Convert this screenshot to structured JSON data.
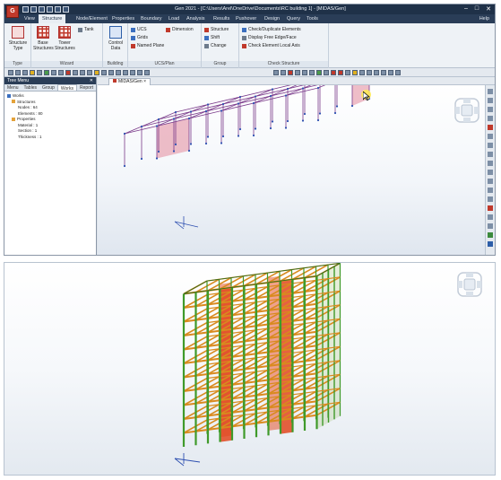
{
  "window": {
    "title": "Gen 2021 - [C:\\Users\\Arel\\OneDrive\\Documents\\RC building 1] - [MIDAS/Gen]",
    "logo_text": "G",
    "controls": [
      "–",
      "□",
      "✕"
    ]
  },
  "menu": {
    "items": [
      "View",
      "Structure",
      "Node/Element",
      "Properties",
      "Boundary",
      "Load",
      "Analysis",
      "Results",
      "Pushover",
      "Design",
      "Query",
      "Tools"
    ],
    "active": "Structure",
    "help": "Help"
  },
  "ribbon": {
    "groups": [
      {
        "label": "Type",
        "buttons": [
          "Structure Type"
        ]
      },
      {
        "label": "Wizard",
        "buttons": [
          "Base Structures",
          "Tower Structures",
          "Tank"
        ]
      },
      {
        "label": "Building",
        "buttons": [
          "Control Data"
        ]
      },
      {
        "label": "UCS/Plan",
        "buttons": [
          "UCS",
          "Grids",
          "Named Plane",
          "Dimension"
        ]
      },
      {
        "label": "Group",
        "buttons": [
          "Structure",
          "Shift",
          "Change"
        ]
      },
      {
        "label": "Check Structure",
        "buttons": [
          "Check/Duplicate Elements",
          "Display Free Edge/Face",
          "Check Element Local Axis"
        ]
      }
    ]
  },
  "nav": {
    "header": "Tree Menu",
    "close": "✕",
    "tabs": [
      "Menu",
      "Tables",
      "Group",
      "Works",
      "Report"
    ],
    "active_tab": "Works",
    "tree": [
      {
        "level": 1,
        "text": "Works"
      },
      {
        "level": 2,
        "text": "Structures"
      },
      {
        "level": 3,
        "text": "Nodes : 64"
      },
      {
        "level": 3,
        "text": "Elements : 80"
      },
      {
        "level": 2,
        "text": "Properties"
      },
      {
        "level": 3,
        "text": "Material : 1"
      },
      {
        "level": 3,
        "text": "Section : 1"
      },
      {
        "level": 3,
        "text": "Thickness : 1"
      }
    ]
  },
  "document_tab": {
    "label": "MIDAS/Gen",
    "close": "×"
  },
  "colors": {
    "frame_wire": "#7a3a8a",
    "node": "#2d4fb0",
    "wall_panel": "#e8a7b5",
    "beam_green": "#3f9a2a",
    "beam_orange": "#d98a1e",
    "wall_red": "#e2461e",
    "accent_blue": "#1f3148"
  },
  "icons": [
    "app-logo",
    "window-minimize",
    "window-maximize",
    "window-close",
    "cursor-arrow",
    "view-cube"
  ]
}
